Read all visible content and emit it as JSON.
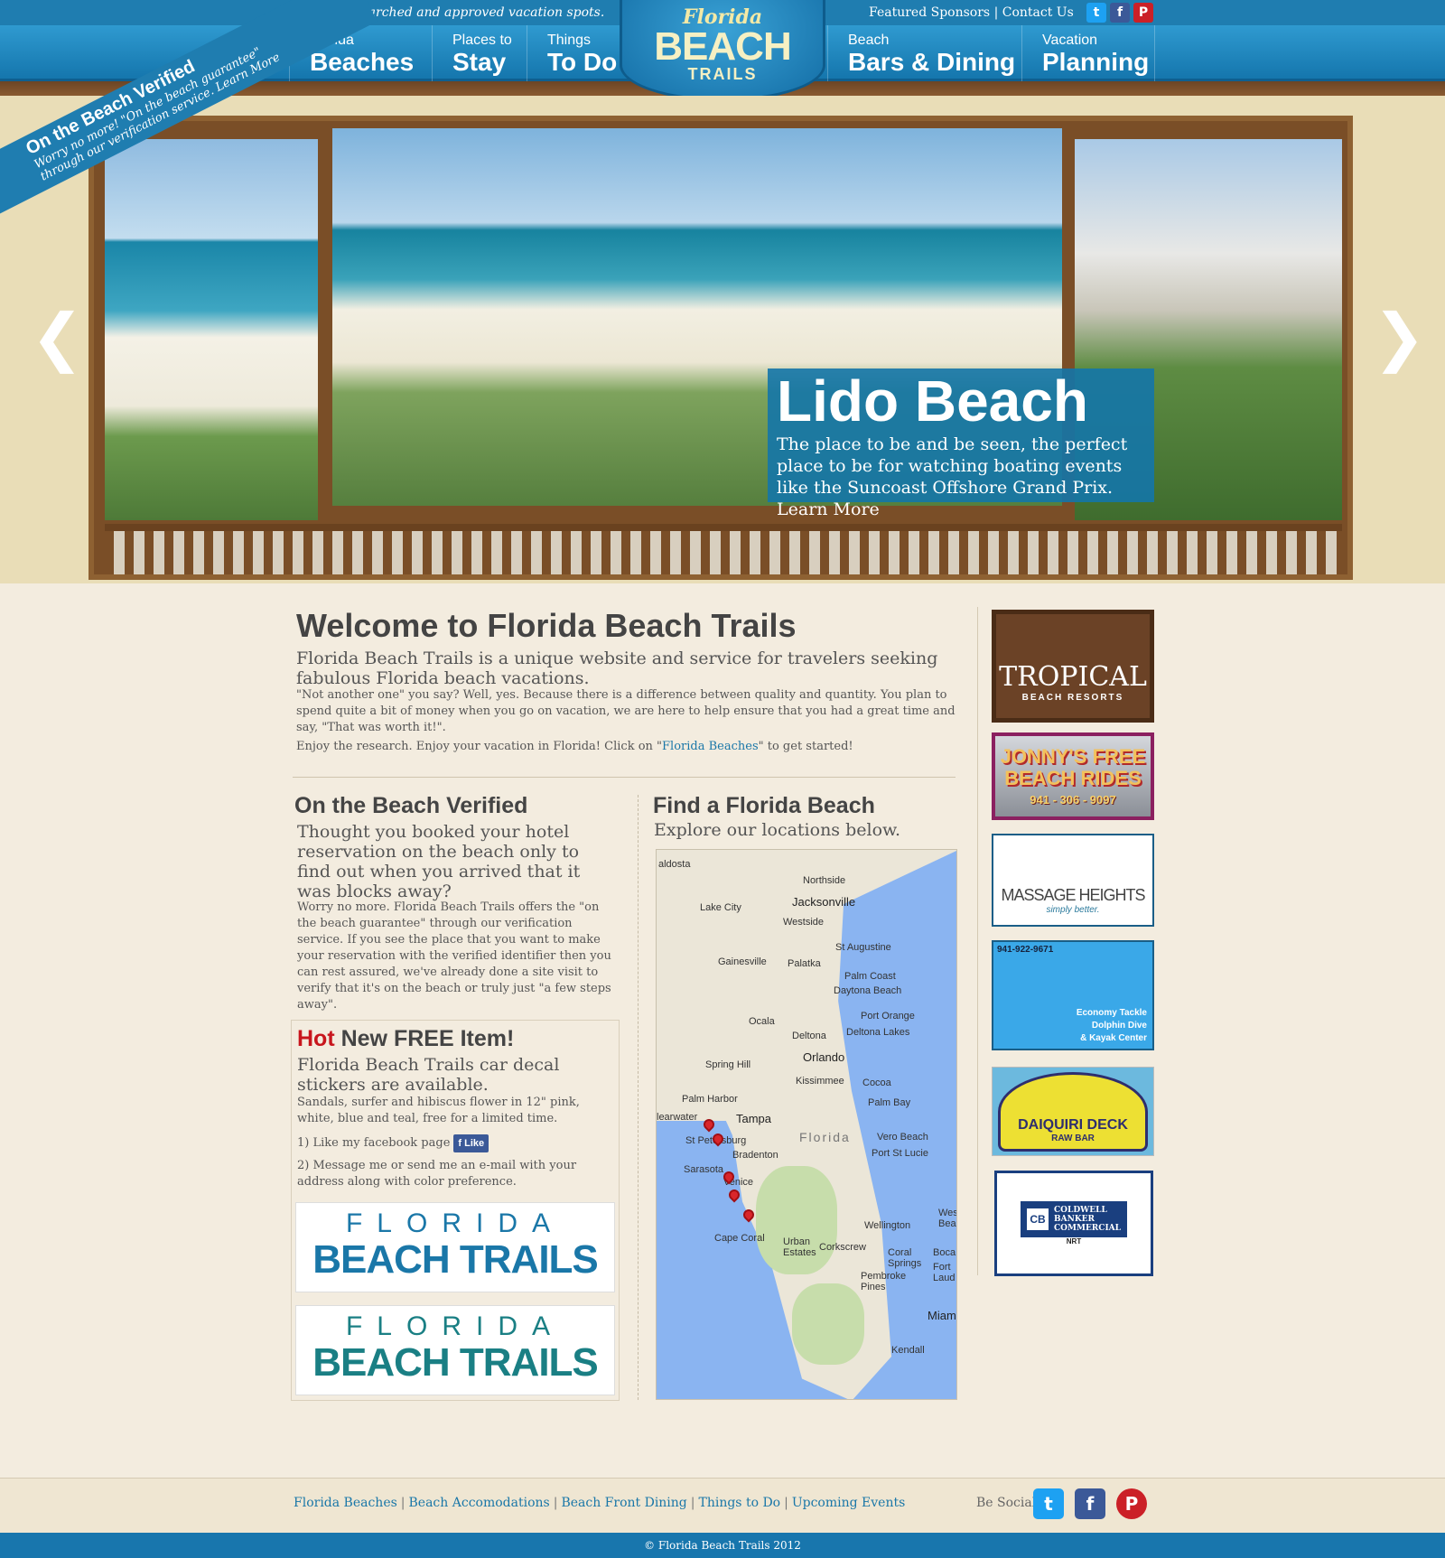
{
  "header": {
    "tagline": "Locally researched and approved vacation spots.",
    "top_links": [
      "Featured Sponsors",
      "Contact Us"
    ],
    "top_links_separator": "|",
    "social": [
      {
        "name": "twitter-icon",
        "glyph": "t",
        "color": "#1da1f2"
      },
      {
        "name": "facebook-icon",
        "glyph": "f",
        "color": "#3b5998"
      },
      {
        "name": "pinterest-icon",
        "glyph": "P",
        "color": "#cb2027"
      }
    ],
    "logo": {
      "line1": "Florida",
      "line2": "BEACH",
      "line3": "TRAILS"
    },
    "nav": [
      {
        "small": "Florida",
        "big": "Beaches"
      },
      {
        "small": "Places to",
        "big": "Stay"
      },
      {
        "small": "Things",
        "big": "To Do"
      },
      {
        "small": "Beach",
        "big": "Bars & Dining"
      },
      {
        "small": "Vacation",
        "big": "Planning"
      }
    ]
  },
  "hero": {
    "ribbon_title": "On the Beach Verified",
    "ribbon_line1": "Worry no more! \"On the beach guarantee\"",
    "ribbon_line2": "through our verification service. Learn More",
    "caption_title": "Lido Beach",
    "caption_text": "The place to be and be seen, the perfect place to be for watching boating events like the Suncoast Offshore Grand Prix.",
    "caption_link": "Learn More",
    "arrow_left": "❮",
    "arrow_right": "❯"
  },
  "welcome": {
    "title": "Welcome to Florida Beach Trails",
    "lead": "Florida Beach Trails is a unique website and service for travelers seeking fabulous Florida beach vacations.",
    "p1": "\"Not another one\" you say?  Well, yes.  Because there is a difference between quality and quantity.  You plan to spend quite a bit of money when you go on vacation, we are here to help ensure that you had a great time and say, \"That was worth it!\".",
    "p2_before": "Enjoy the research. Enjoy your vacation in Florida! Click on \"",
    "p2_link": "Florida Beaches",
    "p2_after": "\" to get started!"
  },
  "verified": {
    "title": "On the Beach Verified",
    "lead": "Thought you booked your hotel reservation on the beach only to find out when you arrived that it was blocks away?",
    "body": "Worry no more.  Florida Beach Trails offers the \"on the beach guarantee\" through our verification service. If you see the place that you want to make your reservation with the verified identifier then you can rest assured, we've already done a site visit to verify that it's on the beach or truly just \"a few steps away\"."
  },
  "hot_item": {
    "hot_word": "Hot",
    "title_rest": " New FREE Item!",
    "lead": "Florida Beach Trails car decal stickers are available.",
    "body": "Sandals, surfer and hibiscus flower in 12\" pink, white, blue and teal, free for a limited time.",
    "step1": "1) Like my facebook page",
    "like_label": "Like",
    "step2": "2) Message me or send me an e-mail with your address along with color preference.",
    "sticker_florida": "FLORIDA",
    "sticker_main": "BEACH TRAILS"
  },
  "find_beach": {
    "title": "Find a Florida Beach",
    "subtitle": "Explore our locations below.",
    "map_cities": [
      "aldosta",
      "Northside",
      "Jacksonville",
      "Lake City",
      "Westside",
      "St Augustine",
      "Gainesville",
      "Palatka",
      "Palm Coast",
      "Daytona Beach",
      "Port Orange",
      "Ocala",
      "Deltona",
      "Deltona Lakes",
      "Orlando",
      "Spring Hill",
      "Kissimmee",
      "Cocoa",
      "Palm Harbor",
      "Palm Bay",
      "learwater",
      "Tampa",
      "Florida",
      "St Petersburg",
      "Vero Beach",
      "Bradenton",
      "Port St Lucie",
      "Sarasota",
      "Venice",
      "Wellington",
      "Cape Coral",
      "Urban Estates",
      "Corkscrew",
      "Coral Springs",
      "Pembroke Pines",
      "Boca",
      "Fort Laud",
      "Miam",
      "Kendall",
      "Wes Bea"
    ]
  },
  "sidebar_ads": {
    "tropical": {
      "title": "TROPICAL",
      "subtitle": "BEACH RESORTS"
    },
    "jonny": {
      "title": "JONNY'S FREE BEACH RIDES",
      "phone": "941 - 306 - 9097"
    },
    "massage": {
      "title": "MASSAGE HEIGHTS",
      "tagline": "simply better."
    },
    "kayak": {
      "phone": "941-922-9671",
      "lines": [
        "Economy Tackle",
        "Dolphin Dive",
        "& Kayak Center"
      ]
    },
    "daiquiri": {
      "title": "DAIQUIRI DECK",
      "subtitle": "RAW BAR"
    },
    "coldwell": {
      "lines": [
        "COLDWELL",
        "BANKER",
        "COMMERCIAL"
      ],
      "mark": "CB",
      "sub": "NRT"
    }
  },
  "footer": {
    "links": [
      "Florida Beaches",
      "Beach Accomodations",
      "Beach Front Dining",
      "Things to Do",
      "Upcoming Events"
    ],
    "be_social": "Be Social",
    "copyright": "© Florida Beach Trails 2012"
  }
}
